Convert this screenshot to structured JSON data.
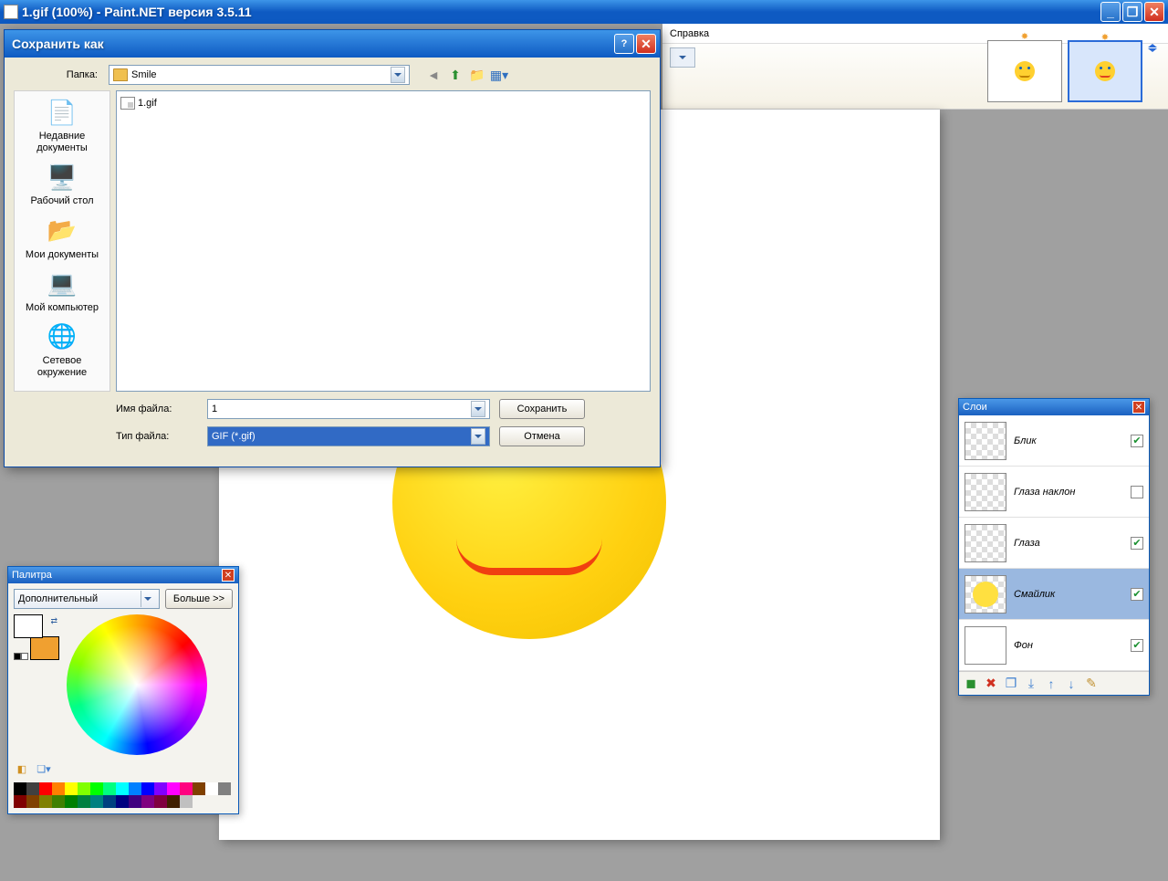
{
  "window": {
    "title": "1.gif (100%) - Paint.NET версия 3.5.11"
  },
  "menubar": {
    "help": "Справка"
  },
  "thumbs": [
    "1",
    "2"
  ],
  "canvas": {},
  "save_dialog": {
    "title": "Сохранить как",
    "folder_label": "Папка:",
    "folder_value": "Smile",
    "places": [
      {
        "label": "Недавние документы"
      },
      {
        "label": "Рабочий стол"
      },
      {
        "label": "Мои документы"
      },
      {
        "label": "Мой компьютер"
      },
      {
        "label": "Сетевое окружение"
      }
    ],
    "file_list": [
      {
        "name": "1.gif"
      }
    ],
    "filename_label": "Имя файла:",
    "filename_value": "1",
    "filetype_label": "Тип файла:",
    "filetype_value": "GIF (*.gif)",
    "save_btn": "Сохранить",
    "cancel_btn": "Отмена"
  },
  "layers": {
    "title": "Слои",
    "items": [
      {
        "name": "Блик",
        "checked": true
      },
      {
        "name": "Глаза наклон",
        "checked": false
      },
      {
        "name": "Глаза",
        "checked": true
      },
      {
        "name": "Смайлик",
        "checked": true,
        "selected": true
      },
      {
        "name": "Фон",
        "checked": true,
        "white": true
      }
    ]
  },
  "palette": {
    "title": "Палитра",
    "mode": "Дополнительный",
    "more_btn": "Больше >>",
    "strip": [
      "#000",
      "#404040",
      "#ff0000",
      "#ff8000",
      "#ffff00",
      "#80ff00",
      "#00ff00",
      "#00ff80",
      "#00ffff",
      "#0080ff",
      "#0000ff",
      "#8000ff",
      "#ff00ff",
      "#ff0080",
      "#804000",
      "#ffffff",
      "#808080",
      "#800000",
      "#804000",
      "#808000",
      "#408000",
      "#008000",
      "#008040",
      "#008080",
      "#004080",
      "#000080",
      "#400080",
      "#800080",
      "#800040",
      "#402000",
      "#c0c0c0"
    ]
  }
}
